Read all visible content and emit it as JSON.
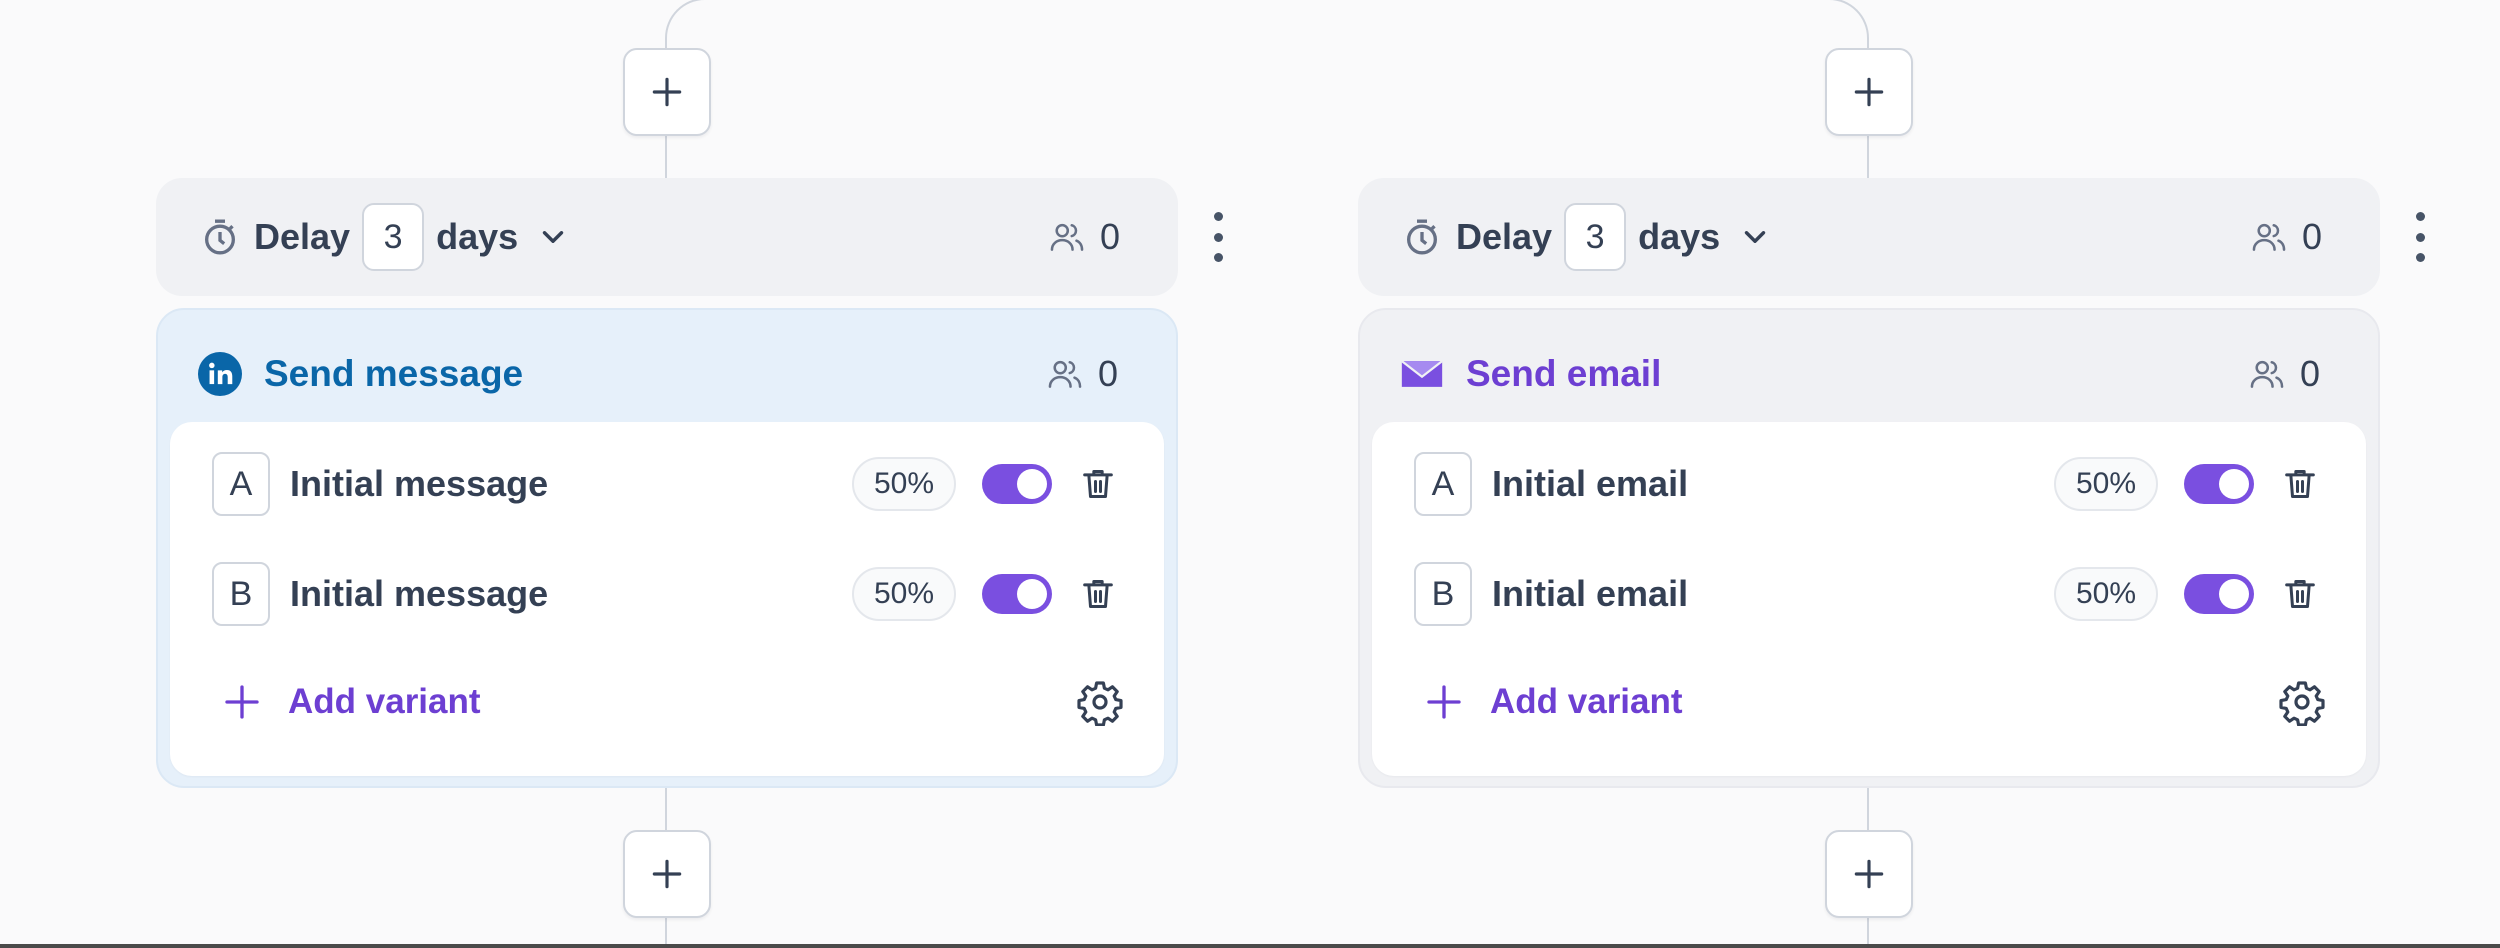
{
  "colors": {
    "accent": "#7a4fe0",
    "linkedin": "#0a66a8",
    "email": "#6d3fd2",
    "text": "#344054"
  },
  "columns": [
    {
      "delay": {
        "label": "Delay",
        "value": "3",
        "unit": "days",
        "count": "0"
      },
      "step": {
        "type": "linkedin",
        "icon": "linkedin-icon",
        "title": "Send message",
        "count": "0",
        "variants": [
          {
            "letter": "A",
            "name": "Initial message",
            "percent": "50%",
            "enabled": true
          },
          {
            "letter": "B",
            "name": "Initial message",
            "percent": "50%",
            "enabled": true
          }
        ],
        "add_label": "Add variant"
      }
    },
    {
      "delay": {
        "label": "Delay",
        "value": "3",
        "unit": "days",
        "count": "0"
      },
      "step": {
        "type": "email",
        "icon": "envelope-icon",
        "title": "Send email",
        "count": "0",
        "variants": [
          {
            "letter": "A",
            "name": "Initial email",
            "percent": "50%",
            "enabled": true
          },
          {
            "letter": "B",
            "name": "Initial email",
            "percent": "50%",
            "enabled": true
          }
        ],
        "add_label": "Add variant"
      }
    }
  ]
}
